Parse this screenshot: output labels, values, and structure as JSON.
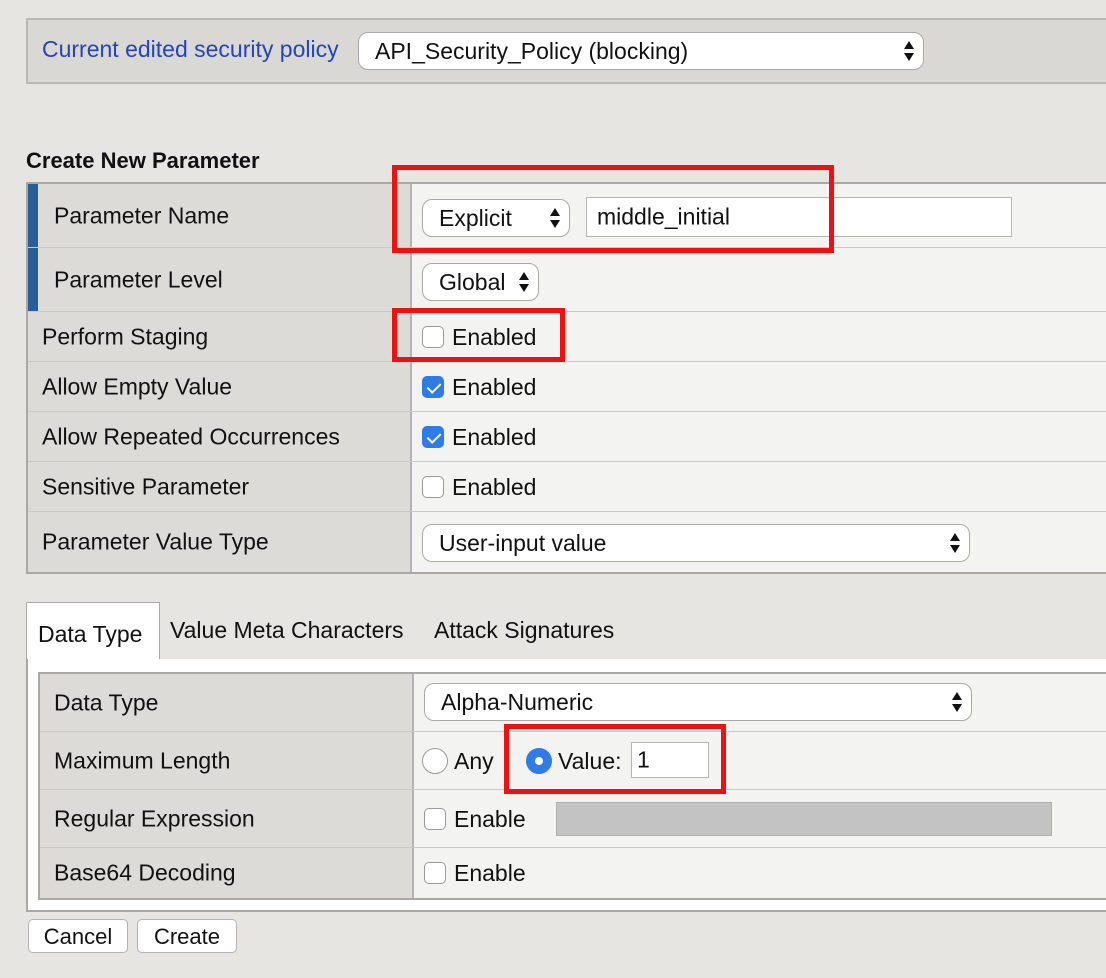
{
  "policy": {
    "label": "Current edited security policy",
    "selected": "API_Security_Policy (blocking)"
  },
  "section_title": "Create New Parameter",
  "parameter": {
    "name_label": "Parameter Name",
    "name_type": "Explicit",
    "name_value": "middle_initial",
    "level_label": "Parameter Level",
    "level_value": "Global",
    "staging_label": "Perform Staging",
    "staging_option": "Enabled",
    "staging_checked": false,
    "empty_label": "Allow Empty Value",
    "empty_option": "Enabled",
    "empty_checked": true,
    "repeated_label": "Allow Repeated Occurrences",
    "repeated_option": "Enabled",
    "repeated_checked": true,
    "sensitive_label": "Sensitive Parameter",
    "sensitive_option": "Enabled",
    "sensitive_checked": false,
    "value_type_label": "Parameter Value Type",
    "value_type": "User-input value"
  },
  "tabs": [
    {
      "label": "Data Type",
      "active": true
    },
    {
      "label": "Value Meta Characters",
      "active": false
    },
    {
      "label": "Attack Signatures",
      "active": false
    }
  ],
  "data_type": {
    "type_label": "Data Type",
    "type_value": "Alpha-Numeric",
    "maxlen_label": "Maximum Length",
    "any_label": "Any",
    "value_label": "Value:",
    "value": "1",
    "regex_label": "Regular Expression",
    "regex_option": "Enable",
    "base64_label": "Base64 Decoding",
    "base64_option": "Enable"
  },
  "buttons": {
    "cancel": "Cancel",
    "create": "Create"
  },
  "colors": {
    "highlight": "#ee1111",
    "accent": "#2f7be8",
    "link": "#2245b8"
  }
}
